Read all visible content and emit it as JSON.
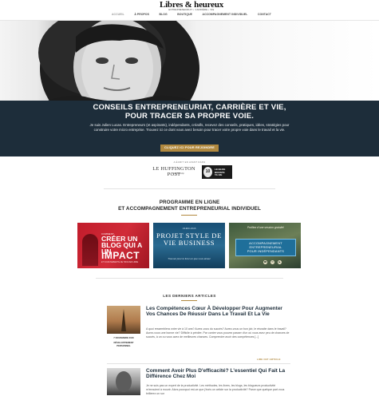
{
  "logo": {
    "main": "Libres & heureux",
    "sub": "ENTREPRENEURIAT • CARRIÈRE • VIE"
  },
  "nav": [
    "ACCUEIL",
    "À PROPOS",
    "BLOG",
    "BOUTIQUE",
    "ACCOMPAGNEMENT INDIVIDUEL",
    "CONTACT"
  ],
  "hero": {
    "title_line1": "CONSEILS ENTREPRENEURIAT, CARRIÈRE ET VIE,",
    "title_line2": "POUR TRACER SA PROPRE VOIE.",
    "text": "Je suis Julien Lucas. Entrepreneurs (et aspirants), indépendants, créatifs, recevez des conseils, pratiques, idées, stratégies pour construire votre micro entreprise. Trouvez ici ce dont vous avez besoin pour tracer votre propre voie dans le travail et la vie.",
    "cta": "CLIQUEZ ICI POUR REJOINDRE"
  },
  "press": {
    "label": "A ÉCRIT EN AVANT DANS",
    "huffpost": "LE HUFFINGTON POST",
    "huffpost_sub": "In Partnership",
    "badge_left": "10",
    "badge_text": [
      "LE BLOG",
      "BOOSTE",
      "TA VIE"
    ]
  },
  "programme": {
    "title_line1": "PROGRAMME EN LIGNE",
    "title_line2": "ET ACCOMPAGNEMENT ENTREPRENEURIAL INDIVIDUEL"
  },
  "cards": [
    {
      "small": "COMMENT",
      "big": "CRÉER UN BLOG QUI A UN",
      "impact": "IMPACT",
      "tag": "ET VOUS PERMETTE DE TROUVER LIBRE"
    },
    {
      "small": "JULIEN LUCAS",
      "big": "PROJET STYLE DE VIE BUSINESS",
      "tag": "Trouvez pour le futur en que vous aimez"
    },
    {
      "q": "Profitez d'une session gratuite!",
      "box": [
        "ACCOMPAGNEMENT",
        "ENTREPRENEURIAL",
        "POUR INDÉPENDANTS"
      ]
    }
  ],
  "articles_title": "LES DERNIERS ARTICLES",
  "articles": [
    {
      "title": "Les Compétences Cœur À Développer Pour Augmenter Vos Chances De Réussir Dans Le Travail Et La Vie",
      "date": "7 NOVEMBRE 2016",
      "category": "DÉVELOPPEMENT PERSONNEL",
      "excerpt": "A quoi ressemblera votre vie à 10 ans? Aurez-vous du succès? Aurez-vous un bon job, le réussite dans le travail? Aurez-vous une bonne vie? Difficile à prédire. Par contre vous pouvez passer d'un où vous avez peu de chances de succès, à un ou vous avez de meilleures chances. Comprendre avoir des compétences [...]",
      "readmore": "LIRE CET ARTICLE"
    },
    {
      "title": "Comment Avoir Plus D'efficacité? L'essentiel Qui Fait La Différence Chez Moi",
      "excerpt": "Je ne suis pas un expert de la productivité. Les méthodes, les livres, les blogs, les blogueurs productivité m'ennuient à mourir. Alors pourquoi est-ce que j'écris un article sur la productivité? Parce que quelque part vous brillerez un sur"
    }
  ],
  "colors": {
    "accent": "#b1893f",
    "dark": "#1d2d3a"
  }
}
